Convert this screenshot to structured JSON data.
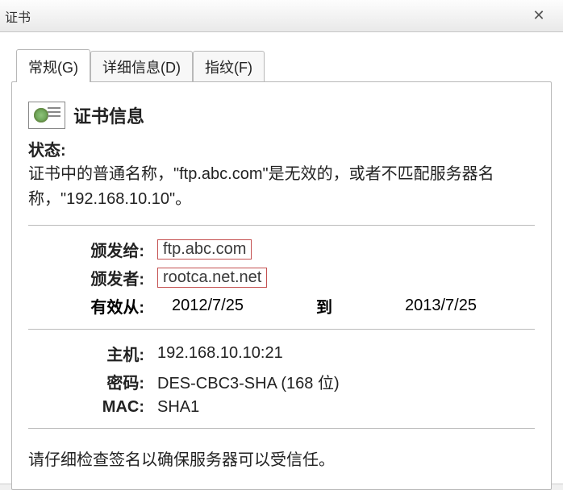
{
  "window": {
    "title": "证书",
    "close": "✕"
  },
  "tabs": [
    {
      "label": "常规(G)"
    },
    {
      "label": "详细信息(D)"
    },
    {
      "label": "指纹(F)"
    }
  ],
  "cert": {
    "heading": "证书信息",
    "status_label": "状态:",
    "status_line1": "证书中的普通名称，\"ftp.abc.com\"是无效的，或者不匹配服务器名",
    "status_line2": "称，\"192.168.10.10\"。",
    "issued_to_label": "颁发给:",
    "issued_to": "ftp.abc.com",
    "issuer_label": "颁发者:",
    "issuer": "rootca.net.net",
    "valid_from_label": "有效从:",
    "valid_from": "2012/7/25",
    "valid_to_word": "到",
    "valid_to": "2013/7/25",
    "host_label": "主机:",
    "host": "192.168.10.10:21",
    "cipher_label": "密码:",
    "cipher": "DES-CBC3-SHA (168 位)",
    "mac_label": "MAC:",
    "mac": "SHA1",
    "footer": "请仔细检查签名以确保服务器可以受信任。"
  }
}
